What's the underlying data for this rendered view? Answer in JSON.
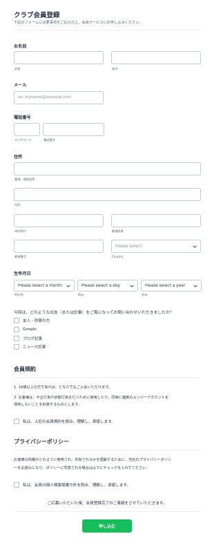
{
  "header": {
    "title": "クラブ会員登録",
    "subtitle": "下記のフォームに必要事項をご記入の上、会員サービスにお申し込みください。"
  },
  "name": {
    "label": "お名前",
    "first_sub": "名前",
    "last_sub": "苗字"
  },
  "email": {
    "label": "メール",
    "placeholder": "ex: myname@example.com"
  },
  "phone": {
    "label": "電話番号",
    "area_sub": "エリアコード",
    "number_sub": "電話番号"
  },
  "address": {
    "label": "住所",
    "street1_sub": "番地・建物名等",
    "street2_sub": "住所",
    "city_sub": "市区町村",
    "state_sub": "都道府県",
    "postal_sub": "郵便番号",
    "country_placeholder": "Please Select",
    "country_sub": "Country"
  },
  "birthdate": {
    "label": "生年月日",
    "month_value": "Please select a month",
    "day_value": "Please select a day",
    "year_value": "Please select a year",
    "month_sub": "Month",
    "day_sub": "Day",
    "year_sub": "Year"
  },
  "referral": {
    "question": "今回は、どのような広告（または記事）をご覧になってお問い合わせいただきましたか？",
    "options": [
      "友人・同僚の方",
      "Google",
      "ブログ記事",
      "ニュース記事"
    ]
  },
  "terms": {
    "title": "会員規約",
    "line1": "1. 18歳以上の方であれば、どなたでもご入会いただけます。",
    "line2a": "2. お客様は、不正行為や詐欺行為を行うために使用したり、同時に複数のメンバーアカウントを",
    "line2b": "保有しないことを約束するものとします。",
    "agree": "私は、上記の会員規約を読み、理解し、承諾します。"
  },
  "privacy": {
    "title": "プライバシーポリシー",
    "line1": "お客様の情報がどのように使用され、共有されるかを理解するために、当社のプライバシーポリシ",
    "line2": "ーをお読みになり、ポリシーに同意される場合は以下にチェックを入れてください。",
    "agree": "私は、会員の個人情報保護方針を読み、理解し、承諾します。"
  },
  "footer": {
    "note": "ご応募いただいた後、会員登録完了のご連絡をさせていただきます。",
    "submit_label": "申し込む"
  },
  "colors": {
    "accent": "#18bd5b",
    "text": "#2c3345",
    "border": "#c3cad8"
  }
}
